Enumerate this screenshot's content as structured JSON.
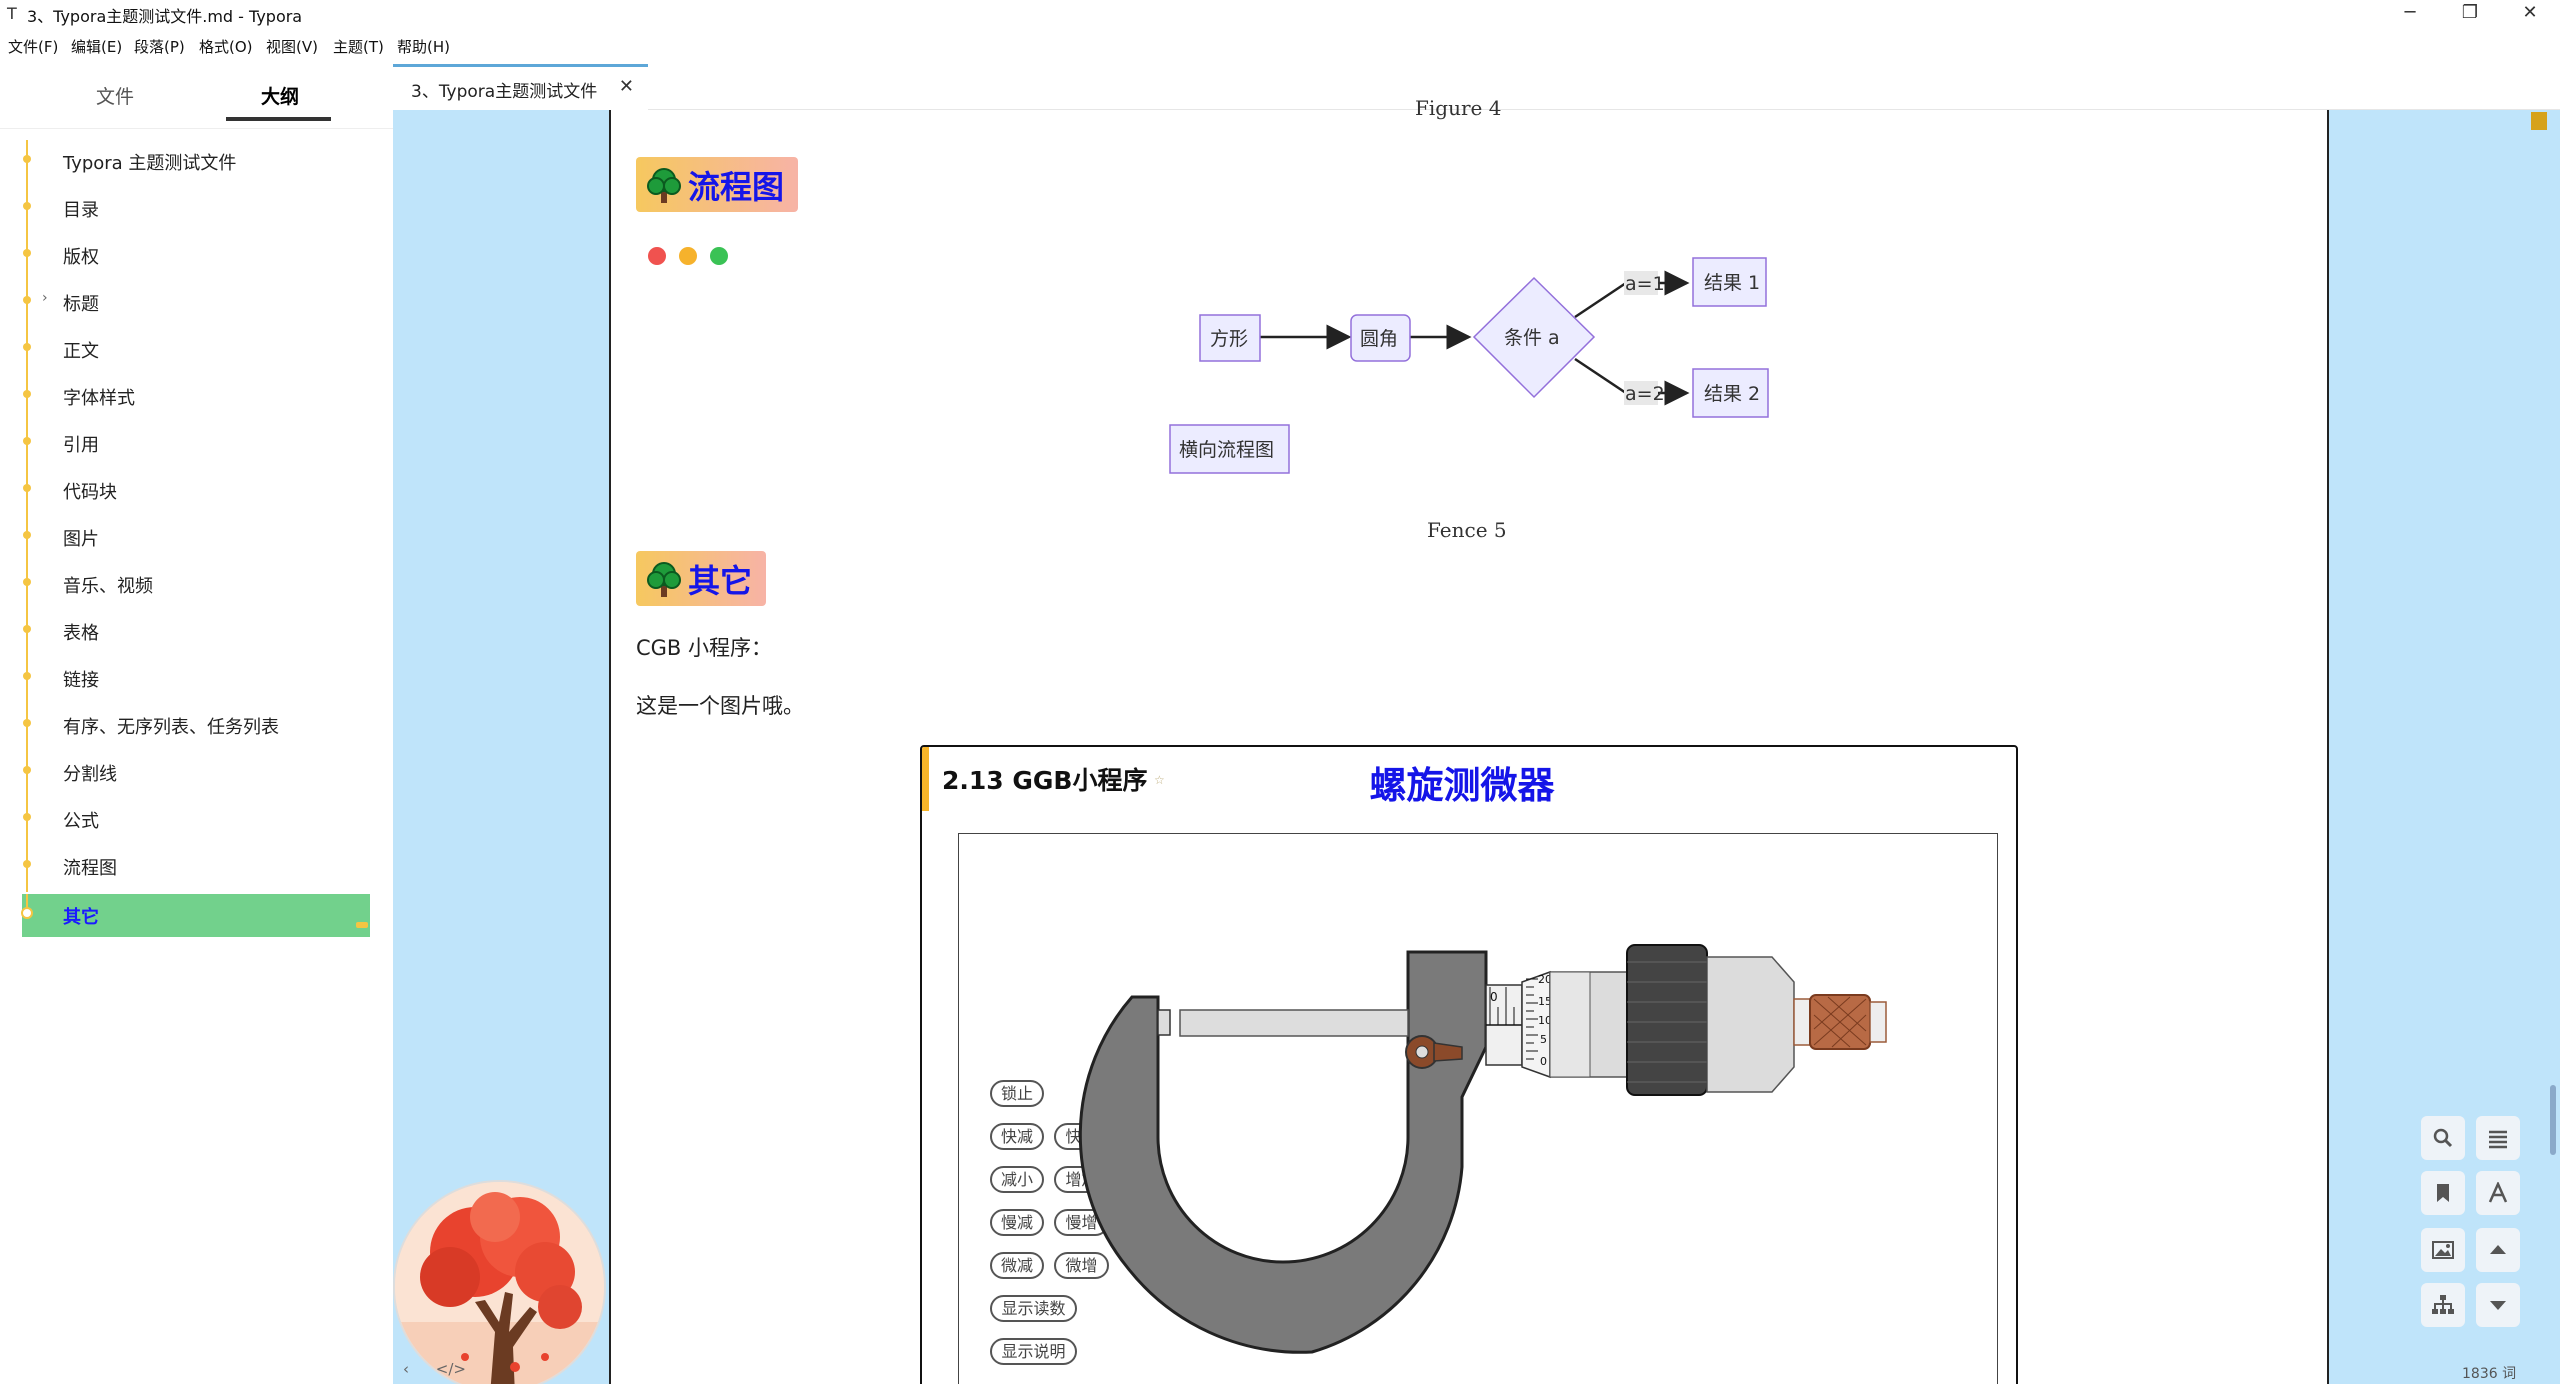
{
  "window": {
    "title": "3、Typora主题测试文件.md - Typora",
    "app_icon": "T",
    "minimize": "─",
    "maximize": "❐",
    "close": "✕"
  },
  "menu": [
    "文件(F)",
    "编辑(E)",
    "段落(P)",
    "格式(O)",
    "视图(V)",
    "主题(T)",
    "帮助(H)"
  ],
  "sidebar": {
    "tabs": [
      "文件",
      "大纲"
    ],
    "active_tab": "大纲",
    "outline": [
      {
        "label": "Typora 主题测试文件",
        "expandable": false
      },
      {
        "label": "目录",
        "expandable": false
      },
      {
        "label": "版权",
        "expandable": false
      },
      {
        "label": "标题",
        "expandable": true
      },
      {
        "label": "正文",
        "expandable": false
      },
      {
        "label": "字体样式",
        "expandable": false
      },
      {
        "label": "引用",
        "expandable": false
      },
      {
        "label": "代码块",
        "expandable": false
      },
      {
        "label": "图片",
        "expandable": false
      },
      {
        "label": "音乐、视频",
        "expandable": false
      },
      {
        "label": "表格",
        "expandable": false
      },
      {
        "label": "链接",
        "expandable": false
      },
      {
        "label": "有序、无序列表、任务列表",
        "expandable": false
      },
      {
        "label": "分割线",
        "expandable": false
      },
      {
        "label": "公式",
        "expandable": false
      },
      {
        "label": "流程图",
        "expandable": false
      },
      {
        "label": "其它",
        "expandable": false,
        "active": true
      }
    ],
    "bottom_tools": [
      "‹",
      "</>"
    ]
  },
  "tab": {
    "label": "3、Typora主题测试文件",
    "close": "✕"
  },
  "document": {
    "figure_caption_top": "Figure 4",
    "heading_flow": "流程图",
    "flowchart": {
      "nodes": [
        "方形",
        "圆角",
        "条件 a",
        "结果 1",
        "结果 2",
        "横向流程图"
      ],
      "edge_labels": [
        "a=1",
        "a=2"
      ]
    },
    "fence_caption": "Fence 5",
    "heading_other": "其它",
    "para1": "CGB 小程序：",
    "para2": "这是一个图片哦。",
    "ggb": {
      "title": "2.13 GGB小程序",
      "star": "☆",
      "header": "螺旋测微器",
      "buttons": [
        "锁止",
        "快减",
        "快增",
        "减小",
        "增加",
        "慢减",
        "慢增",
        "微减",
        "微增",
        "显示读数",
        "显示说明"
      ],
      "scale_labels": [
        "20",
        "15",
        "10",
        "5",
        "0"
      ],
      "sleeve_label": "0"
    },
    "colors": {
      "heading_text": "#1515e8",
      "canvas_bg": "#bfe4fa",
      "active_outline_bg": "#72d18c",
      "outline_line": "#f5c542",
      "window_dots": [
        "#f0524f",
        "#f6b22c",
        "#3ac255"
      ]
    }
  },
  "tools": [
    "search-icon",
    "outline-list-icon",
    "bookmark-icon",
    "font-icon",
    "image-icon",
    "up-arrow-icon",
    "sitemap-icon",
    "down-arrow-icon"
  ],
  "status": {
    "word_count": "1836 词"
  }
}
